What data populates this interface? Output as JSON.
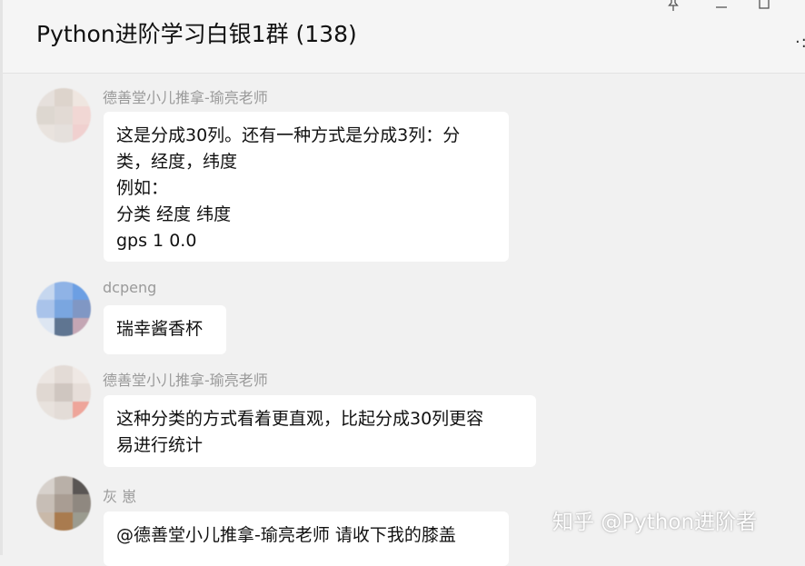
{
  "window": {
    "title": "Python进阶学习白银1群 (138)",
    "more_glyph": "·:",
    "controls": {
      "pin_icon": "pin-icon",
      "minimize_icon": "minimize-icon",
      "maximize_icon": "maximize-icon"
    }
  },
  "messages": [
    {
      "sender": "德善堂小儿推拿-瑜亮老师",
      "lines": [
        "这是分成30列。还有一种方式是分成3列：分",
        "类，经度，纬度",
        "例如：",
        "分类 经度 纬度",
        "gps 1 0.0"
      ],
      "avatar_colors": [
        "#e6e0dc",
        "#ddd4cc",
        "#efe6e0",
        "#ddd7d0",
        "#e2dad4",
        "#f1d7d4",
        "#e9e3de",
        "#e5e0dc",
        "#f0d0cf"
      ]
    },
    {
      "sender": "dcpeng",
      "lines": [
        "瑞幸酱香杯"
      ],
      "avatar_colors": [
        "#c6d7ef",
        "#8fb3e6",
        "#6c9fe3",
        "#a9c3ea",
        "#7aa6e0",
        "#8097c4",
        "#dde6f2",
        "#5f7591",
        "#c4a6b4"
      ]
    },
    {
      "sender": "德善堂小儿推拿-瑜亮老师",
      "lines": [
        "这种分类的方式看着更直观，比起分成30列更容",
        "易进行统计"
      ],
      "avatar_colors": [
        "#ece6e2",
        "#e3dbd6",
        "#efe8e4",
        "#e0d8d2",
        "#cfc6c0",
        "#e6ddd8",
        "#e8e2dd",
        "#e3dcd7",
        "#eea59a"
      ]
    },
    {
      "sender": "灰 崽",
      "lines": [
        "@德善堂小儿推拿-瑜亮老师 请收下我的膝盖"
      ],
      "avatar_colors": [
        "#d7d1cc",
        "#b9b0a8",
        "#5a5654",
        "#c7beb6",
        "#a99d93",
        "#8f8880",
        "#c9b9a9",
        "#a97b4f",
        "#9b9b8f"
      ]
    }
  ],
  "watermark": "知乎 @Python进阶者"
}
